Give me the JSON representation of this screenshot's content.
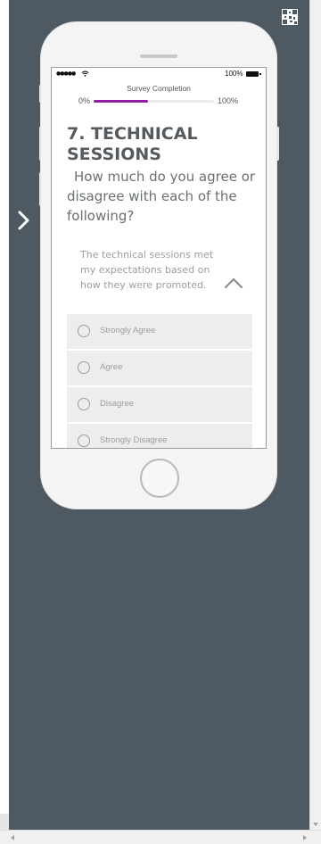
{
  "status_bar": {
    "signal": "●●●●●",
    "battery_label": "100%"
  },
  "progress": {
    "label": "Survey Completion",
    "min_label": "0%",
    "max_label": "100%",
    "fraction": 0.45,
    "color": "#8f1f9e"
  },
  "question": {
    "title": "7. TECHNICAL SESSIONS",
    "text": "How much do you agree or disagree with each of the following?"
  },
  "statement": {
    "text": "The technical sessions met my expectations based on how they were promoted.",
    "toggle_icon": "chevron-up-icon"
  },
  "options": [
    {
      "label": "Strongly Agree"
    },
    {
      "label": "Agree"
    },
    {
      "label": "Disagree"
    },
    {
      "label": "Strongly Disagree"
    }
  ],
  "navigation": {
    "next_icon": "chevron-right-icon"
  },
  "colors": {
    "background": "#4f5961",
    "accent": "#8f1f9e",
    "option_bg": "#ededed"
  }
}
